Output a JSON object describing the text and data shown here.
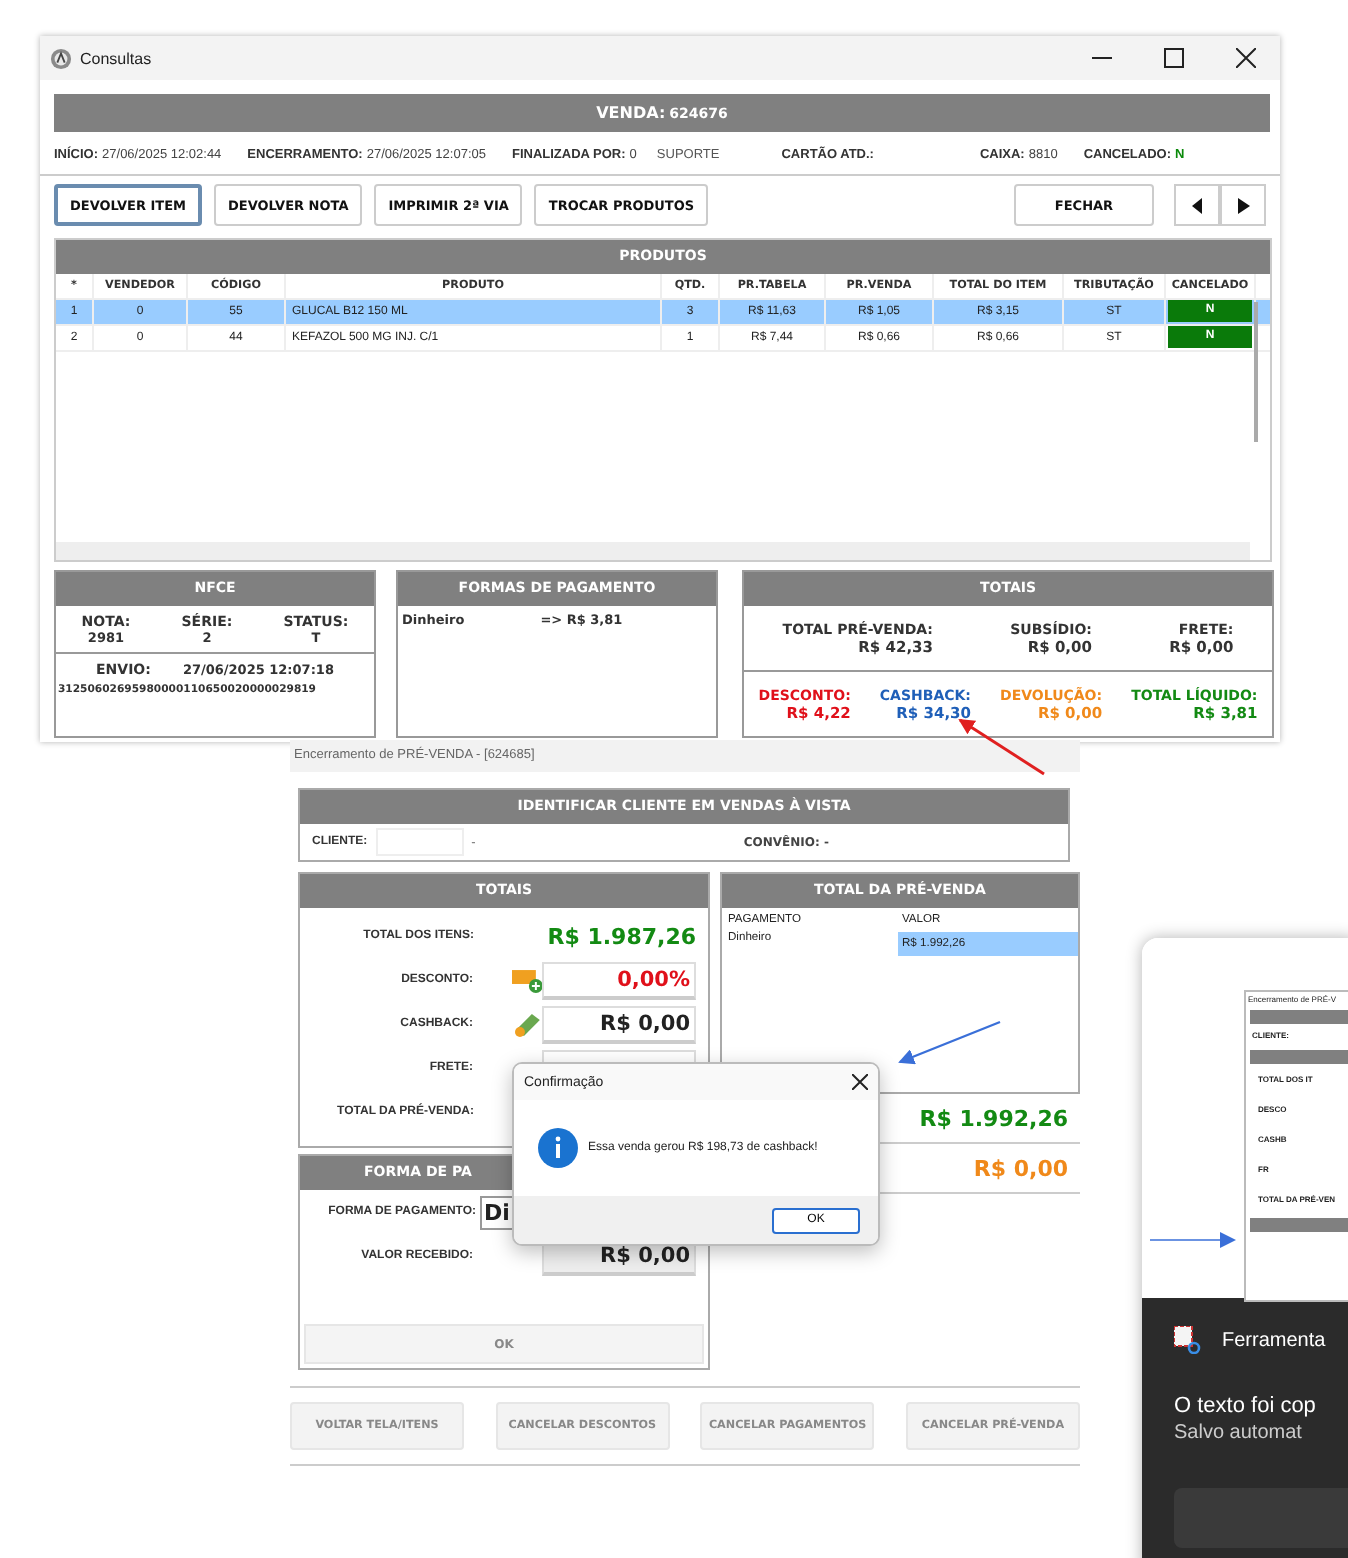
{
  "consultas": {
    "title": "Consultas",
    "venda": {
      "label": "VENDA:",
      "number": "624676"
    },
    "info": [
      {
        "label": "INÍCIO:",
        "value": "27/06/2025 12:02:44"
      },
      {
        "label": "ENCERRAMENTO:",
        "value": "27/06/2025 12:07:05"
      },
      {
        "label": "FINALIZADA POR:",
        "value": "0",
        "extra": "SUPORTE"
      },
      {
        "label": "CARTÃO ATD.:"
      },
      {
        "label": "CAIXA:",
        "value": "8810"
      },
      {
        "label": "CANCELADO:",
        "value": "N",
        "kind": "flag"
      }
    ],
    "buttons": [
      {
        "label": "DEVOLVER ITEM",
        "focused": true
      },
      {
        "label": "DEVOLVER NOTA",
        "focused": false
      },
      {
        "label": "IMPRIMIR 2ª VIA",
        "focused": false
      },
      {
        "label": "TROCAR PRODUTOS",
        "focused": false
      }
    ],
    "close_button": "FECHAR",
    "products": {
      "title": "PRODUTOS",
      "columns": [
        "*",
        "VENDEDOR",
        "CÓDIGO",
        "PRODUTO",
        "QTD.",
        "PR.TABELA",
        "PR.VENDA",
        "TOTAL DO ITEM",
        "TRIBUTAÇÃO",
        "CANCELADO"
      ],
      "rows": [
        {
          "selected": true,
          "cells": [
            "1",
            "0",
            "55",
            "GLUCAL B12 150 ML",
            "3",
            "R$ 11,63",
            "R$ 1,05",
            "R$ 3,15",
            "ST",
            "N"
          ]
        },
        {
          "selected": false,
          "cells": [
            "2",
            "0",
            "44",
            "KEFAZOL 500 MG INJ. C/1",
            "1",
            "R$ 7,44",
            "R$ 0,66",
            "R$ 0,66",
            "ST",
            "N"
          ]
        }
      ]
    },
    "nfce": {
      "title": "NFCE",
      "fields": [
        {
          "label": "NOTA:",
          "value": "2981"
        },
        {
          "label": "SÉRIE:",
          "value": "2"
        },
        {
          "label": "STATUS:",
          "value": "T"
        }
      ],
      "envio_label": "ENVIO:",
      "envio_value": "27/06/2025 12:07:18",
      "key": "31250602695980000110650020000029819"
    },
    "payments": {
      "title": "FORMAS DE PAGAMENTO",
      "rows": [
        {
          "method": "Dinheiro",
          "amount": "=> R$ 3,81"
        }
      ]
    },
    "totals": {
      "title": "TOTAIS",
      "top": [
        {
          "label": "TOTAL PRÉ-VENDA:",
          "value": "R$ 42,33"
        },
        {
          "label": "SUBSÍDIO:",
          "value": "R$ 0,00"
        },
        {
          "label": "FRETE:",
          "value": "R$ 0,00"
        }
      ],
      "bottom": [
        {
          "label": "DESCONTO:",
          "value": "R$ 4,22",
          "color": "#e0101a"
        },
        {
          "label": "CASHBACK:",
          "value": "R$ 34,30",
          "color": "#1f5fb8"
        },
        {
          "label": "DEVOLUÇÃO:",
          "value": "R$ 0,00",
          "color": "#f0891a"
        },
        {
          "label": "TOTAL LÍQUIDO:",
          "value": "R$ 3,81",
          "color": "#138a13"
        }
      ]
    }
  },
  "encerramento": {
    "title": "Encerramento de PRÉ-VENDA  -  [624685]",
    "cliente_panel": {
      "title": "IDENTIFICAR CLIENTE EM VENDAS À VISTA",
      "cliente_label": "CLIENTE:",
      "cliente_dash": "-",
      "convenio": "CONVÊNIO: -"
    },
    "totais": {
      "title": "TOTAIS",
      "total_itens_label": "TOTAL DOS ITENS:",
      "total_itens_value": "R$ 1.987,26",
      "desconto_label": "DESCONTO:",
      "desconto_value": "0,00%",
      "cashback_label": "CASHBACK:",
      "cashback_value": "R$ 0,00",
      "frete_label": "FRETE:",
      "total_pv_label": "TOTAL DA PRÉ-VENDA:"
    },
    "forma": {
      "title": "FORMA DE PA",
      "forma_label": "FORMA DE PAGAMENTO:",
      "forma_value": "Di",
      "recebido_label": "VALOR RECEBIDO:",
      "recebido_value": "R$ 0,00",
      "ok": "OK"
    },
    "total_pv": {
      "title": "TOTAL DA PRÉ-VENDA",
      "columns": [
        "PAGAMENTO",
        "VALOR"
      ],
      "rows": [
        {
          "method": "Dinheiro",
          "value": "R$ 1.992,26",
          "selected": true
        }
      ],
      "total": "R$ 1.992,26",
      "troco": "R$ 0,00"
    },
    "buttons": [
      "VOLTAR TELA/ITENS",
      "CANCELAR DESCONTOS",
      "CANCELAR PAGAMENTOS",
      "CANCELAR PRÉ-VENDA"
    ]
  },
  "dialog": {
    "title": "Confirmação",
    "message": "Essa venda gerou R$ 198,73 de cashback!",
    "ok": "OK"
  },
  "notification": {
    "thumbnail": {
      "title": "Encerramento de PRÉ-V",
      "labels": [
        "CLIENTE:",
        "TOTAL DOS IT",
        "DESCO",
        "CASHB",
        "FR",
        "TOTAL DA PRÉ-VEN"
      ]
    },
    "app": "Ferramenta",
    "message": "O texto foi cop",
    "detail": "Salvo automat"
  }
}
